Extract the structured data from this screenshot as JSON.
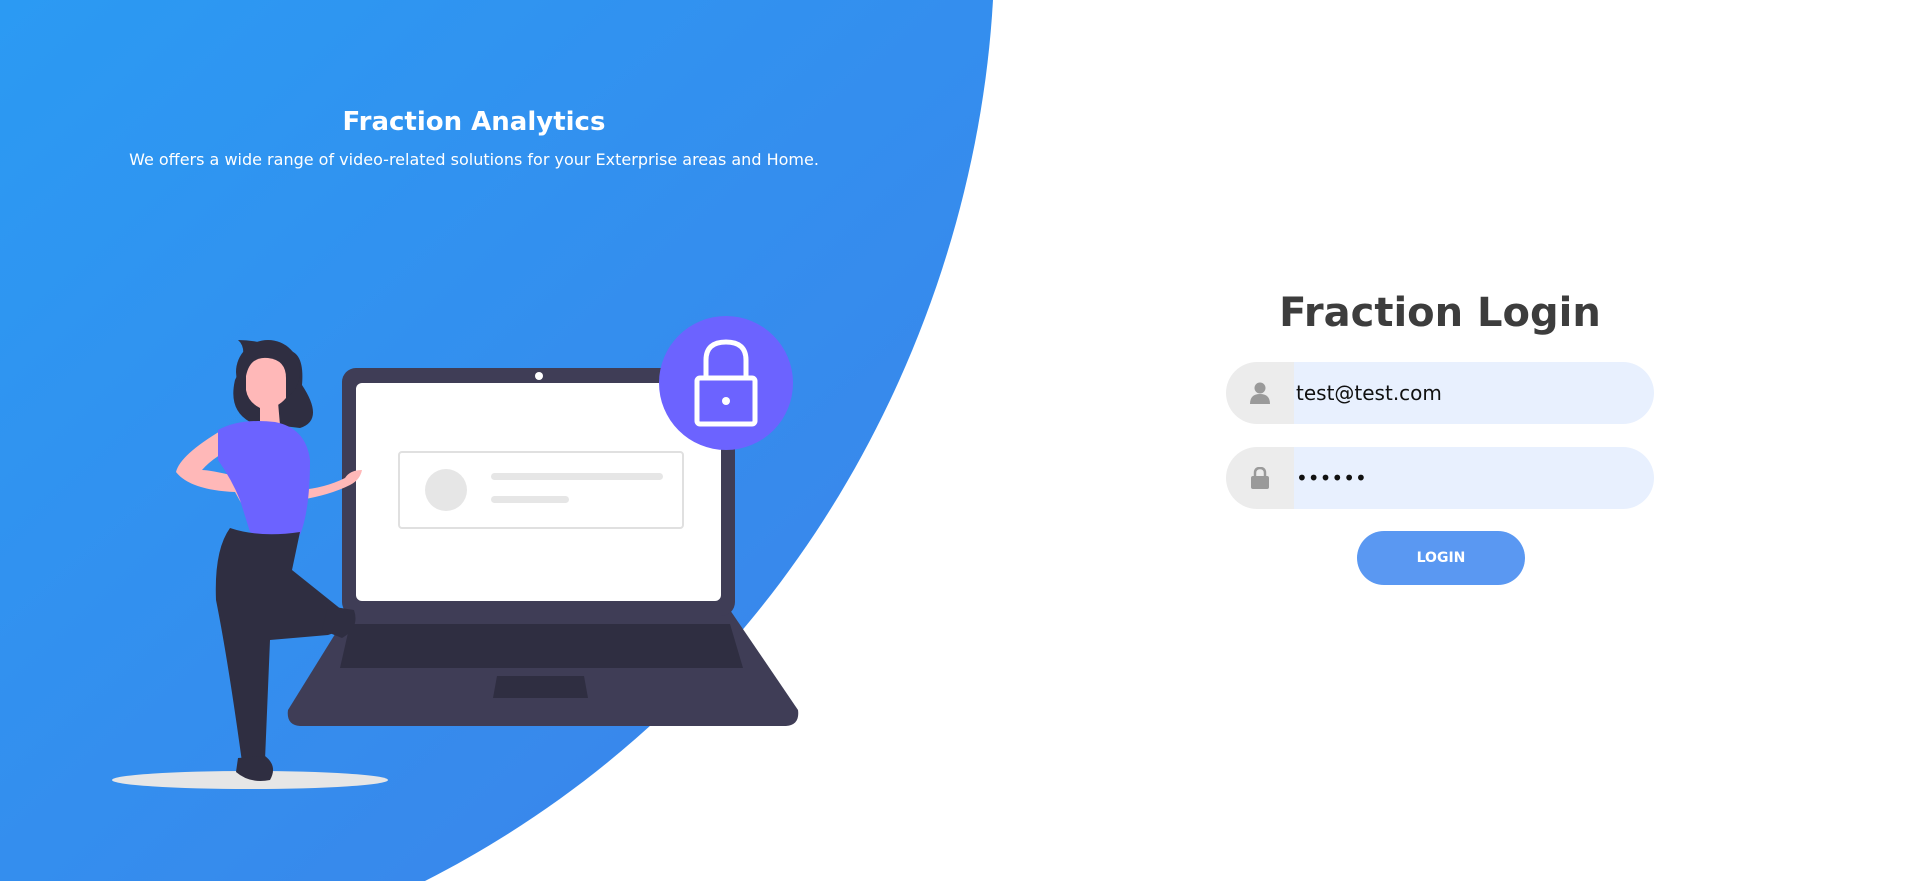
{
  "hero": {
    "title": "Fraction Analytics",
    "subtitle": "We offers a wide range of video-related solutions for your Exterprise areas and Home."
  },
  "login": {
    "title": "Fraction Login",
    "email": {
      "icon": "user-icon",
      "value": "test@test.com"
    },
    "password": {
      "icon": "lock-icon",
      "value": "••••••"
    },
    "button_label": "LOGIN"
  },
  "colors": {
    "hero_gradient_start": "#2b9af3",
    "hero_gradient_end": "#3b86ea",
    "accent": "#5a98f2",
    "lock_badge": "#6c63ff",
    "input_bg": "#e8f0fe",
    "icon_bg": "#ececec",
    "title_text": "#3d3d3d"
  }
}
